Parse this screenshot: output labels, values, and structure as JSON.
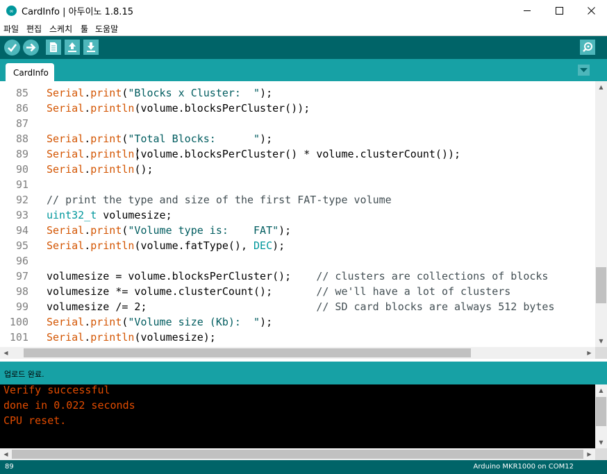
{
  "window": {
    "title": "CardInfo | 아두이노 1.8.15",
    "minimize_glyph": "—",
    "maximize_glyph": "☐",
    "close_glyph": "✕"
  },
  "menu": [
    "파일",
    "편집",
    "스케치",
    "툴",
    "도움말"
  ],
  "toolbar": {
    "icons": [
      "verify-icon",
      "upload-icon",
      "new-icon",
      "open-icon",
      "save-icon",
      "serial-monitor-icon"
    ]
  },
  "tab": {
    "label": "CardInfo"
  },
  "editor": {
    "lines": [
      {
        "num": "85",
        "parts": [
          [
            "k",
            "Serial"
          ],
          [
            "n",
            "."
          ],
          [
            "k",
            "print"
          ],
          [
            "n",
            "("
          ],
          [
            "s",
            "\"Blocks x Cluster:  \""
          ],
          [
            "n",
            ");"
          ]
        ]
      },
      {
        "num": "86",
        "parts": [
          [
            "k",
            "Serial"
          ],
          [
            "n",
            "."
          ],
          [
            "k",
            "println"
          ],
          [
            "n",
            "(volume.blocksPerCluster());"
          ]
        ]
      },
      {
        "num": "87",
        "parts": []
      },
      {
        "num": "88",
        "parts": [
          [
            "k",
            "Serial"
          ],
          [
            "n",
            "."
          ],
          [
            "k",
            "print"
          ],
          [
            "n",
            "("
          ],
          [
            "s",
            "\"Total Blocks:      \""
          ],
          [
            "n",
            ");"
          ]
        ]
      },
      {
        "num": "89",
        "parts": [
          [
            "k",
            "Serial"
          ],
          [
            "n",
            "."
          ],
          [
            "k",
            "println"
          ],
          [
            "n",
            "(volume.blocksPerCluster() * volume.clusterCount());"
          ]
        ]
      },
      {
        "num": "90",
        "parts": [
          [
            "k",
            "Serial"
          ],
          [
            "n",
            "."
          ],
          [
            "k",
            "println"
          ],
          [
            "n",
            "();"
          ]
        ]
      },
      {
        "num": "91",
        "parts": []
      },
      {
        "num": "92",
        "parts": [
          [
            "c",
            "// print the type and size of the first FAT-type volume"
          ]
        ]
      },
      {
        "num": "93",
        "parts": [
          [
            "t",
            "uint32_t"
          ],
          [
            "n",
            " volumesize;"
          ]
        ]
      },
      {
        "num": "94",
        "parts": [
          [
            "k",
            "Serial"
          ],
          [
            "n",
            "."
          ],
          [
            "k",
            "print"
          ],
          [
            "n",
            "("
          ],
          [
            "s",
            "\"Volume type is:    FAT\""
          ],
          [
            "n",
            ");"
          ]
        ]
      },
      {
        "num": "95",
        "parts": [
          [
            "k",
            "Serial"
          ],
          [
            "n",
            "."
          ],
          [
            "k",
            "println"
          ],
          [
            "n",
            "(volume.fatType(), "
          ],
          [
            "t",
            "DEC"
          ],
          [
            "n",
            ");"
          ]
        ]
      },
      {
        "num": "96",
        "parts": []
      },
      {
        "num": "97",
        "parts": [
          [
            "n",
            "volumesize = volume.blocksPerCluster();    "
          ],
          [
            "c",
            "// clusters are collections of blocks"
          ]
        ]
      },
      {
        "num": "98",
        "parts": [
          [
            "n",
            "volumesize *= volume.clusterCount();       "
          ],
          [
            "c",
            "// we'll have a lot of clusters"
          ]
        ]
      },
      {
        "num": "99",
        "parts": [
          [
            "n",
            "volumesize /= 2;                           "
          ],
          [
            "c",
            "// SD card blocks are always 512 bytes"
          ]
        ]
      },
      {
        "num": "100",
        "parts": [
          [
            "k",
            "Serial"
          ],
          [
            "n",
            "."
          ],
          [
            "k",
            "print"
          ],
          [
            "n",
            "("
          ],
          [
            "s",
            "\"Volume size (Kb):  \""
          ],
          [
            "n",
            ");"
          ]
        ]
      },
      {
        "num": "101",
        "parts": [
          [
            "k",
            "Serial"
          ],
          [
            "n",
            "."
          ],
          [
            "k",
            "println"
          ],
          [
            "n",
            "(volumesize);"
          ]
        ]
      }
    ]
  },
  "status": {
    "message": "업로드 완료."
  },
  "console": {
    "lines": [
      "Verify successful",
      "done in 0.022 seconds",
      "CPU reset."
    ]
  },
  "footer": {
    "line_number": "89",
    "board": "Arduino MKR1000 on COM12"
  },
  "colors": {
    "toolbar": "#006468",
    "tabrow": "#17a1a5",
    "button": "#4db7bb",
    "keyword": "#d35400",
    "string": "#005c5f",
    "comment": "#434f54",
    "type": "#00979c",
    "console_text": "#e34c00"
  }
}
